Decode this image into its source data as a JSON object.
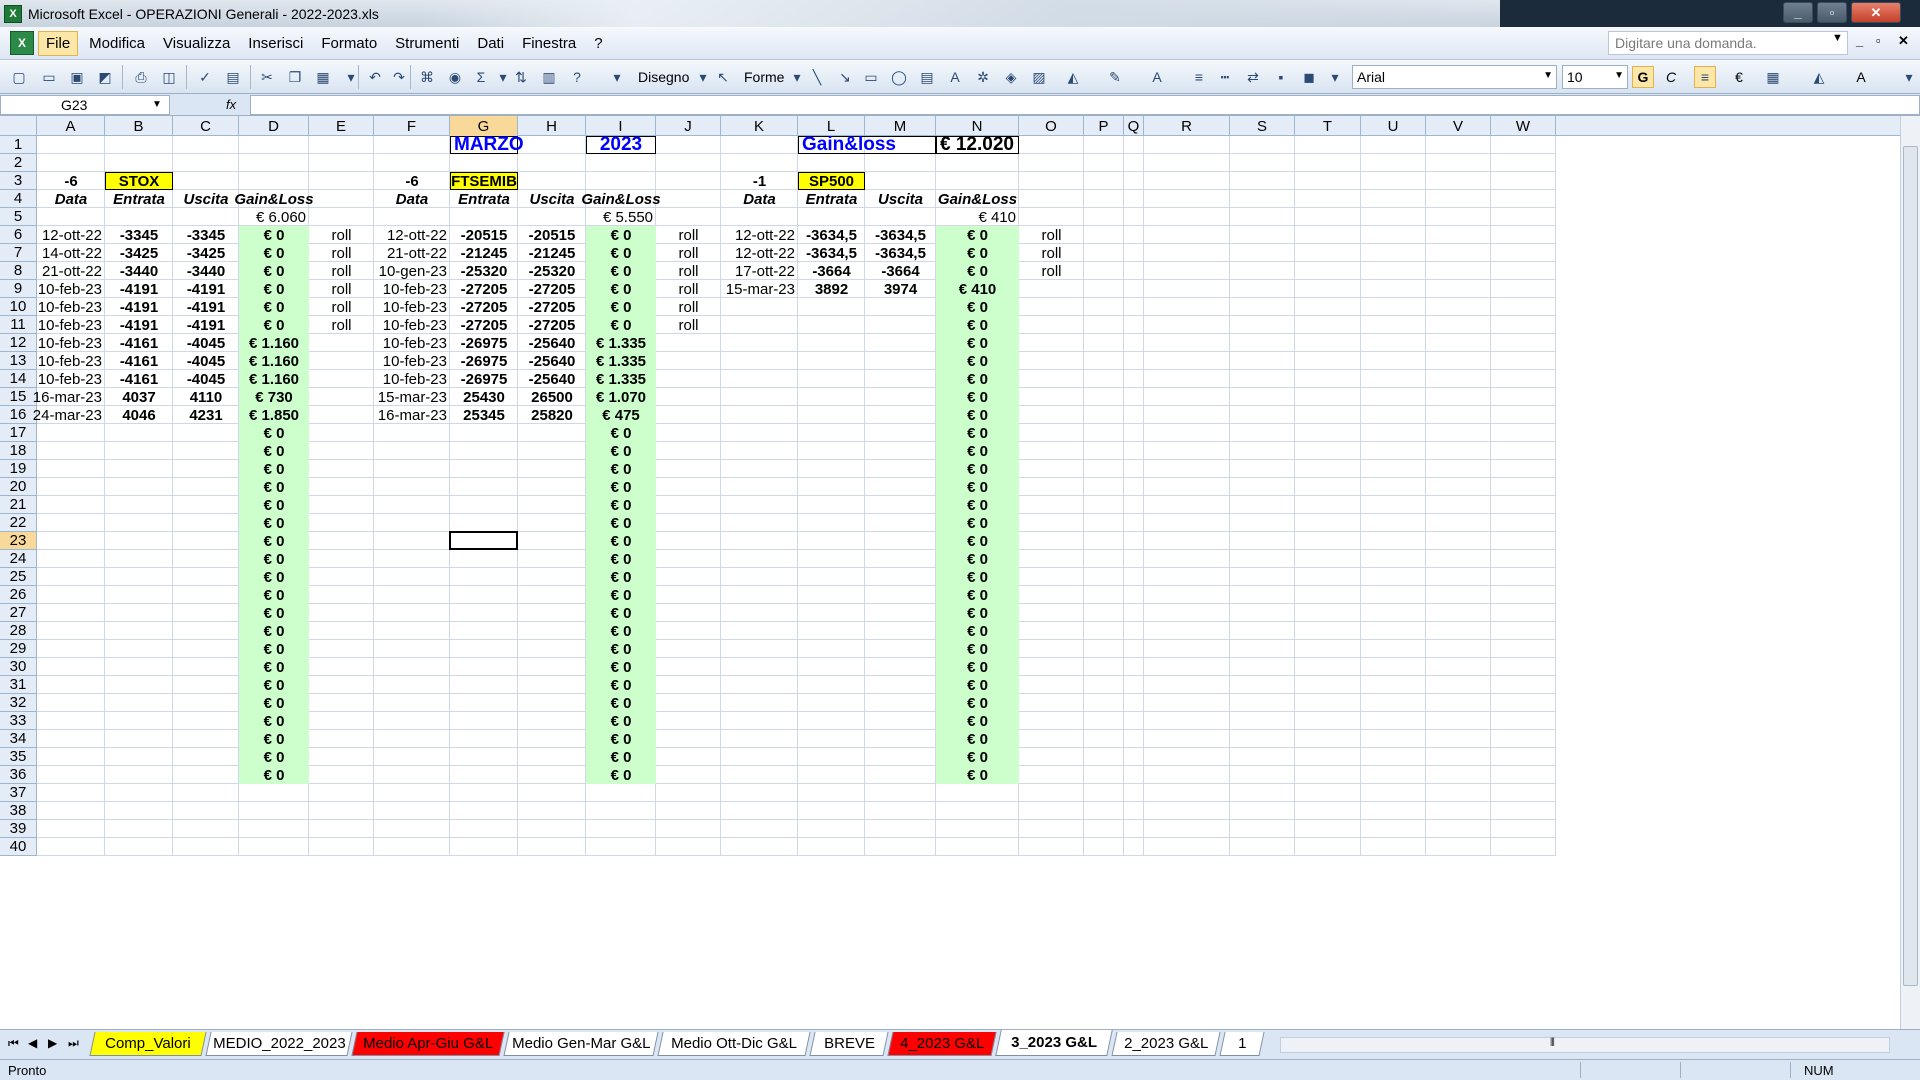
{
  "window": {
    "title": "Microsoft Excel - OPERAZIONI Generali - 2022-2023.xls",
    "minimize": "_",
    "maximize": "▫",
    "close": "✕"
  },
  "menu": {
    "items": [
      "File",
      "Modifica",
      "Visualizza",
      "Inserisci",
      "Formato",
      "Strumenti",
      "Dati",
      "Finestra",
      "?"
    ],
    "ask_placeholder": "Digitare una domanda.",
    "doc_controls": [
      "_",
      "▫",
      "✕"
    ]
  },
  "toolbar": {
    "draw_label": "Disegno",
    "shapes_label": "Forme",
    "font_name": "Arial",
    "font_size": "10",
    "bold_label": "G",
    "italic_label": "C",
    "euro_label": "€",
    "sigma_label": "Σ"
  },
  "formula_bar": {
    "name_box": "G23",
    "fx_label": "fx",
    "formula": ""
  },
  "grid": {
    "columns": [
      "A",
      "B",
      "C",
      "D",
      "E",
      "F",
      "G",
      "H",
      "I",
      "J",
      "K",
      "L",
      "M",
      "N",
      "O",
      "P",
      "Q",
      "R",
      "S",
      "T",
      "U",
      "V",
      "W"
    ],
    "selected_column": "G",
    "selected_row": 23,
    "row_count": 40,
    "colors": {
      "green_fill": "#ccffcc",
      "yellow_fill": "#ffff00",
      "header_blue": "#0000ff",
      "selection": "#f9d99a"
    },
    "header": {
      "month": "MARZO",
      "year": "2023",
      "gainloss_label": "Gain&loss",
      "gainloss_total": "€ 12.020"
    },
    "blocks": [
      {
        "qty": "-6",
        "name": "STOX",
        "col_labels": [
          "Data",
          "Entrata",
          "Uscita",
          "Gain&Loss"
        ],
        "total": "€ 6.060",
        "rows": [
          [
            "12-ott-22",
            "-3345",
            "-3345",
            "€ 0",
            "roll"
          ],
          [
            "14-ott-22",
            "-3425",
            "-3425",
            "€ 0",
            "roll"
          ],
          [
            "21-ott-22",
            "-3440",
            "-3440",
            "€ 0",
            "roll"
          ],
          [
            "10-feb-23",
            "-4191",
            "-4191",
            "€ 0",
            "roll"
          ],
          [
            "10-feb-23",
            "-4191",
            "-4191",
            "€ 0",
            "roll"
          ],
          [
            "10-feb-23",
            "-4191",
            "-4191",
            "€ 0",
            "roll"
          ],
          [
            "10-feb-23",
            "-4161",
            "-4045",
            "€ 1.160",
            ""
          ],
          [
            "10-feb-23",
            "-4161",
            "-4045",
            "€ 1.160",
            ""
          ],
          [
            "10-feb-23",
            "-4161",
            "-4045",
            "€ 1.160",
            ""
          ],
          [
            "16-mar-23",
            "4037",
            "4110",
            "€ 730",
            ""
          ],
          [
            "24-mar-23",
            "4046",
            "4231",
            "€ 1.850",
            ""
          ]
        ]
      },
      {
        "qty": "-6",
        "name": "FTSEMIB",
        "col_labels": [
          "Data",
          "Entrata",
          "Uscita",
          "Gain&Loss"
        ],
        "total": "€ 5.550",
        "rows": [
          [
            "12-ott-22",
            "-20515",
            "-20515",
            "€ 0",
            "roll"
          ],
          [
            "21-ott-22",
            "-21245",
            "-21245",
            "€ 0",
            "roll"
          ],
          [
            "10-gen-23",
            "-25320",
            "-25320",
            "€ 0",
            "roll"
          ],
          [
            "10-feb-23",
            "-27205",
            "-27205",
            "€ 0",
            "roll"
          ],
          [
            "10-feb-23",
            "-27205",
            "-27205",
            "€ 0",
            "roll"
          ],
          [
            "10-feb-23",
            "-27205",
            "-27205",
            "€ 0",
            "roll"
          ],
          [
            "10-feb-23",
            "-26975",
            "-25640",
            "€ 1.335",
            ""
          ],
          [
            "10-feb-23",
            "-26975",
            "-25640",
            "€ 1.335",
            ""
          ],
          [
            "10-feb-23",
            "-26975",
            "-25640",
            "€ 1.335",
            ""
          ],
          [
            "15-mar-23",
            "25430",
            "26500",
            "€ 1.070",
            ""
          ],
          [
            "16-mar-23",
            "25345",
            "25820",
            "€ 475",
            ""
          ]
        ]
      },
      {
        "qty": "-1",
        "name": "SP500",
        "col_labels": [
          "Data",
          "Entrata",
          "Uscita",
          "Gain&Loss"
        ],
        "total": "€ 410",
        "rows": [
          [
            "12-ott-22",
            "-3634,5",
            "-3634,5",
            "€ 0",
            "roll"
          ],
          [
            "12-ott-22",
            "-3634,5",
            "-3634,5",
            "€ 0",
            "roll"
          ],
          [
            "17-ott-22",
            "-3664",
            "-3664",
            "€ 0",
            "roll"
          ],
          [
            "15-mar-23",
            "3892",
            "3974",
            "€ 410",
            ""
          ]
        ]
      }
    ],
    "zero_value": "€ 0"
  },
  "sheet_tabs": {
    "tabs": [
      {
        "label": "Comp_Valori",
        "color": "#ffff00"
      },
      {
        "label": "MEDIO_2022_2023",
        "color": "#ffffff"
      },
      {
        "label": "Medio Apr-Giu G&L",
        "color": "#ff0000"
      },
      {
        "label": "Medio Gen-Mar G&L",
        "color": "#ffffff"
      },
      {
        "label": "Medio Ott-Dic G&L",
        "color": "#ffffff"
      },
      {
        "label": "BREVE",
        "color": "#ffffff"
      },
      {
        "label": "4_2023 G&L",
        "color": "#ff0000"
      },
      {
        "label": "3_2023 G&L",
        "color": "#ffffff"
      },
      {
        "label": "2_2023 G&L",
        "color": "#ffffff"
      },
      {
        "label": "1",
        "color": "#ffffff"
      }
    ],
    "active": "3_2023 G&L"
  },
  "status": {
    "text": "Pronto",
    "num": "NUM"
  }
}
